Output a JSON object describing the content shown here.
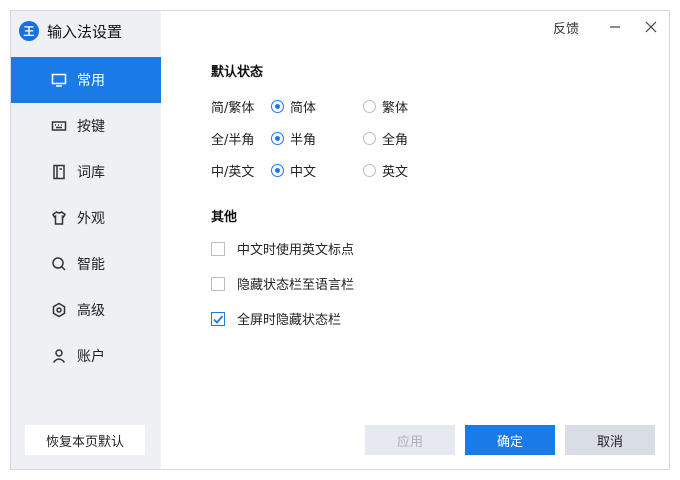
{
  "window": {
    "title": "输入法设置",
    "logo_text": "王",
    "feedback_label": "反馈",
    "accent_color": "#1a7ae8"
  },
  "sidebar": {
    "items": [
      {
        "label": "常用",
        "icon": "monitor-icon",
        "active": true
      },
      {
        "label": "按键",
        "icon": "keyboard-icon",
        "active": false
      },
      {
        "label": "词库",
        "icon": "book-icon",
        "active": false
      },
      {
        "label": "外观",
        "icon": "shirt-icon",
        "active": false
      },
      {
        "label": "智能",
        "icon": "search-icon",
        "active": false
      },
      {
        "label": "高级",
        "icon": "hexagon-icon",
        "active": false
      },
      {
        "label": "账户",
        "icon": "user-icon",
        "active": false
      }
    ],
    "restore_label": "恢复本页默认"
  },
  "default_state": {
    "title": "默认状态",
    "rows": [
      {
        "label": "简/繁体",
        "options": [
          "简体",
          "繁体"
        ],
        "selected": 0
      },
      {
        "label": "全/半角",
        "options": [
          "半角",
          "全角"
        ],
        "selected": 0
      },
      {
        "label": "中/英文",
        "options": [
          "中文",
          "英文"
        ],
        "selected": 0
      }
    ]
  },
  "other": {
    "title": "其他",
    "options": [
      {
        "label": "中文时使用英文标点",
        "checked": false
      },
      {
        "label": "隐藏状态栏至语言栏",
        "checked": false
      },
      {
        "label": "全屏时隐藏状态栏",
        "checked": true
      }
    ]
  },
  "footer": {
    "apply_label": "应用",
    "ok_label": "确定",
    "cancel_label": "取消"
  }
}
